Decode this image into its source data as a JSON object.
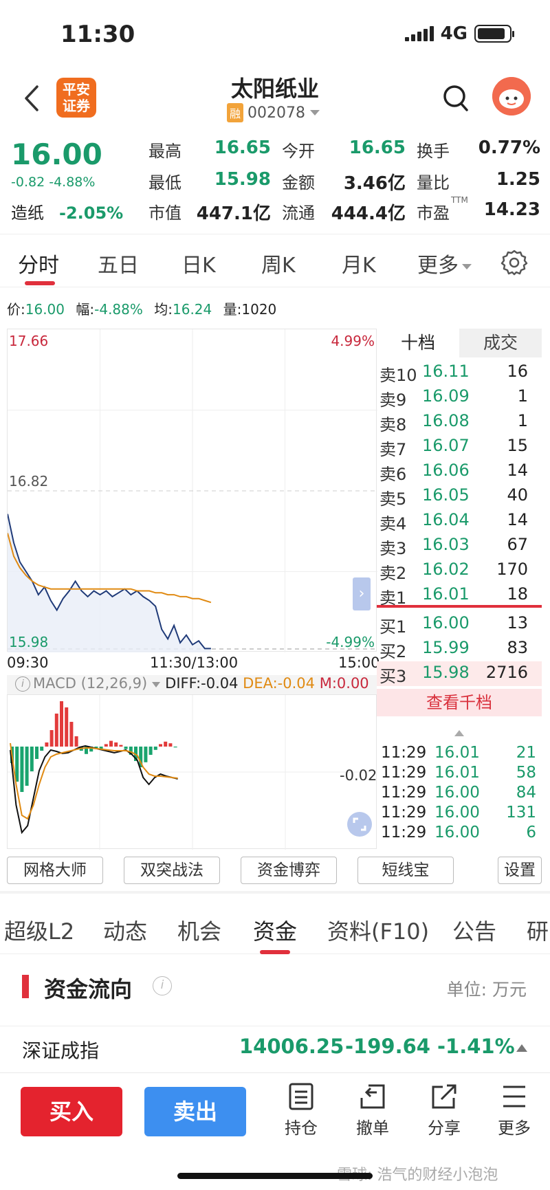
{
  "status": {
    "time": "11:30",
    "network": "4G"
  },
  "header": {
    "logo_text": "平安证券",
    "title": "太阳纸业",
    "margin_badge": "融",
    "code": "002078"
  },
  "quote": {
    "price": "16.00",
    "change": "-0.82",
    "change_pct": "-4.88%",
    "sector_name": "造纸",
    "sector_pct": "-2.05%",
    "fields": [
      {
        "label": "最高",
        "value": "16.65"
      },
      {
        "label": "今开",
        "value": "16.65"
      },
      {
        "label": "换手",
        "value": "0.77%"
      },
      {
        "label": "最低",
        "value": "15.98"
      },
      {
        "label": "金额",
        "value": "3.46亿"
      },
      {
        "label": "量比",
        "value": "1.25"
      },
      {
        "label": "市值",
        "value": "447.1亿"
      },
      {
        "label": "流通",
        "value": "444.4亿"
      },
      {
        "label": "市盈",
        "value": "14.23",
        "sup": "TTM"
      }
    ]
  },
  "tabs": [
    "分时",
    "五日",
    "日K",
    "周K",
    "月K",
    "更多"
  ],
  "infoline": {
    "price_label": "价:",
    "price": "16.00",
    "range_label": "幅:",
    "range": "-4.88%",
    "avg_label": "均:",
    "avg": "16.24",
    "vol_label": "量:",
    "vol": "1020"
  },
  "chart_data": {
    "type": "line",
    "y_top": "17.66",
    "y_mid": "16.82",
    "y_bottom": "15.98",
    "pct_top": "4.99%",
    "pct_bottom": "-4.99%",
    "x_labels": [
      "09:30",
      "11:30/13:00",
      "15:00"
    ],
    "ylim": [
      15.98,
      17.66
    ],
    "series": [
      {
        "values": [
          16.7,
          16.55,
          16.45,
          16.4,
          16.35,
          16.28,
          16.32,
          16.25,
          16.2,
          16.26,
          16.3,
          16.35,
          16.3,
          16.27,
          16.3,
          16.28,
          16.3,
          16.27,
          16.29,
          16.31,
          16.28,
          16.3,
          16.27,
          16.25,
          16.22,
          16.1,
          16.05,
          16.12,
          16.03,
          16.07,
          16.02,
          16.04,
          16.0,
          16.0
        ]
      },
      {
        "values": [
          16.6,
          16.48,
          16.42,
          16.38,
          16.35,
          16.33,
          16.32,
          16.31,
          16.31,
          16.31,
          16.31,
          16.31,
          16.31,
          16.31,
          16.31,
          16.31,
          16.31,
          16.31,
          16.31,
          16.31,
          16.31,
          16.3,
          16.3,
          16.3,
          16.29,
          16.29,
          16.28,
          16.28,
          16.27,
          16.27,
          16.26,
          16.26,
          16.25,
          16.24
        ]
      }
    ]
  },
  "macd": {
    "label": "MACD (12,26,9)",
    "diff": "DIFF:-0.04",
    "dea": "DEA:-0.04",
    "m": "M:0.00",
    "scale": "-0.02"
  },
  "orderbook": {
    "tab_active": "十档",
    "tab_other": "成交",
    "rows": [
      {
        "label": "卖10",
        "price": "16.11",
        "vol": "16"
      },
      {
        "label": "卖9",
        "price": "16.09",
        "vol": "1"
      },
      {
        "label": "卖8",
        "price": "16.08",
        "vol": "1"
      },
      {
        "label": "卖7",
        "price": "16.07",
        "vol": "15"
      },
      {
        "label": "卖6",
        "price": "16.06",
        "vol": "14"
      },
      {
        "label": "卖5",
        "price": "16.05",
        "vol": "40"
      },
      {
        "label": "卖4",
        "price": "16.04",
        "vol": "14"
      },
      {
        "label": "卖3",
        "price": "16.03",
        "vol": "67"
      },
      {
        "label": "卖2",
        "price": "16.02",
        "vol": "170"
      },
      {
        "label": "卖1",
        "price": "16.01",
        "vol": "18"
      },
      {
        "label": "买1",
        "price": "16.00",
        "vol": "13"
      },
      {
        "label": "买2",
        "price": "15.99",
        "vol": "83"
      },
      {
        "label": "买3",
        "price": "15.98",
        "vol": "2716"
      }
    ],
    "view_more": "查看千档",
    "ticks": [
      {
        "time": "11:29",
        "price": "16.01",
        "vol": "21"
      },
      {
        "time": "11:29",
        "price": "16.01",
        "vol": "58"
      },
      {
        "time": "11:29",
        "price": "16.00",
        "vol": "84"
      },
      {
        "time": "11:29",
        "price": "16.00",
        "vol": "131"
      },
      {
        "time": "11:29",
        "price": "16.00",
        "vol": "6"
      }
    ]
  },
  "tools": [
    "网格大师",
    "双突战法",
    "资金博弈",
    "短线宝",
    "设置"
  ],
  "section_tabs": [
    "超级L2",
    "动态",
    "机会",
    "资金",
    "资料(F10)",
    "公告",
    "研"
  ],
  "flow": {
    "title": "资金流向",
    "info": "i",
    "unit": "单位: 万元"
  },
  "index": {
    "name": "深证成指",
    "value": "14006.25",
    "change": "-199.64",
    "pct": "-1.41%"
  },
  "bottom": {
    "buy": "买入",
    "sell": "卖出",
    "actions": [
      "持仓",
      "撤单",
      "分享",
      "更多"
    ],
    "watermark": "雪球: 浩气的财经小泡泡"
  },
  "colors": {
    "up": "#c8283c",
    "down": "#1a9a6a",
    "accent": "#e0303c",
    "sell_btn": "#3d8ff0",
    "buy_btn": "#e4232e"
  }
}
